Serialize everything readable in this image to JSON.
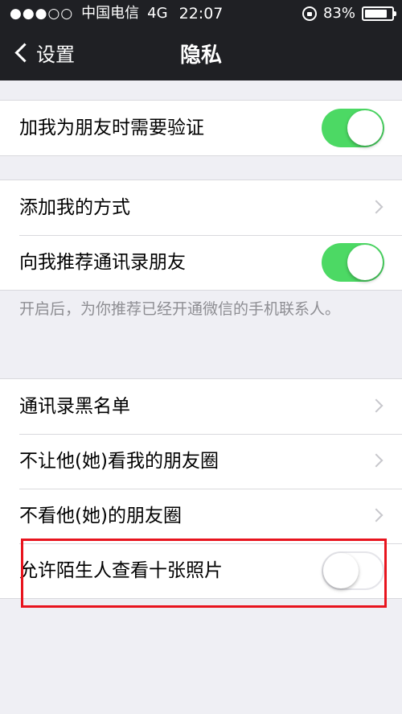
{
  "status_bar": {
    "signal": "●●●○○",
    "carrier": "中国电信",
    "network": "4G",
    "time": "22:07",
    "battery_percent": "83%",
    "battery_level": 0.83
  },
  "nav": {
    "back_label": "设置",
    "title": "隐私"
  },
  "sections": {
    "verify": {
      "label": "加我为朋友时需要验证",
      "on": true
    },
    "add_method": {
      "label": "添加我的方式"
    },
    "recommend": {
      "label": "向我推荐通讯录朋友",
      "on": true
    },
    "recommend_note": "开启后，为你推荐已经开通微信的手机联系人。",
    "blacklist": {
      "label": "通讯录黑名单"
    },
    "hide_moments": {
      "label": "不让他(她)看我的朋友圈"
    },
    "not_view_moments": {
      "label": "不看他(她)的朋友圈"
    },
    "stranger_photos": {
      "label": "允许陌生人查看十张照片",
      "on": false
    }
  },
  "colors": {
    "switch_on": "#4cd964",
    "highlight_border": "#e8141e",
    "header_bg": "#1f2024"
  }
}
